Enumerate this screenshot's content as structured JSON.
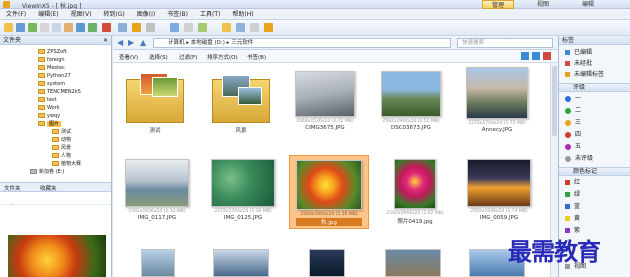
{
  "window": {
    "title": "ViewInX5 - [ 秋.jpg ]"
  },
  "ribbon_tabs": [
    {
      "label": "管理"
    },
    {
      "label": "视图"
    },
    {
      "label": "编辑"
    }
  ],
  "menu": [
    {
      "label": "文件(F)"
    },
    {
      "label": "编辑(E)"
    },
    {
      "label": "视图(V)"
    },
    {
      "label": "转到(G)"
    },
    {
      "label": "图像(I)"
    },
    {
      "label": "书签(B)"
    },
    {
      "label": "工具(T)"
    },
    {
      "label": "帮助(H)"
    }
  ],
  "left_panel": {
    "header": "文件夹",
    "tree": [
      {
        "label": "ZPSZoft"
      },
      {
        "label": "foreign"
      },
      {
        "label": "Mestec"
      },
      {
        "label": "Python27"
      },
      {
        "label": "system"
      },
      {
        "label": "TENCMEN2k5"
      },
      {
        "label": "test"
      },
      {
        "label": "Work"
      },
      {
        "label": "ywqy"
      },
      {
        "label": "图片"
      },
      {
        "label": "测试"
      },
      {
        "label": "动物"
      },
      {
        "label": "风景"
      },
      {
        "label": "人物"
      },
      {
        "label": "植物大赛"
      },
      {
        "label": "新加卷 (E:)"
      }
    ],
    "tabs": [
      {
        "label": "文件夹"
      },
      {
        "label": "收藏夹"
      }
    ],
    "preview_header": "预览"
  },
  "pathbar": {
    "crumbs": [
      "计算机",
      "本地磁盘 (D:)",
      "三元软件"
    ],
    "search_placeholder": "快速搜索"
  },
  "filterbar": {
    "items": [
      {
        "label": "查看(V)"
      },
      {
        "label": "选择(S)"
      },
      {
        "label": "过滤(F)"
      },
      {
        "label": "排序方式(O)"
      },
      {
        "label": "书签(B)"
      }
    ]
  },
  "thumbnails": [
    {
      "name": "测试",
      "meta": "",
      "kind": "folder"
    },
    {
      "name": "风景",
      "meta": "",
      "kind": "folder"
    },
    {
      "name": "CIMG3675.JPG",
      "meta": "2048x1536x24 (2.72 MB)",
      "kind": "photo"
    },
    {
      "name": "DSC03673.JPG",
      "meta": "2592x1944x24 (2.52 MB)",
      "kind": "photo"
    },
    {
      "name": "Annecy.JPG",
      "meta": "2272x1704x24 (1.75 MB)",
      "kind": "photo"
    },
    {
      "name": "IMG_0117.JPG",
      "meta": "2592x1936x24 (2.32 MB)",
      "kind": "photo"
    },
    {
      "name": "IMG_0125.JPG",
      "meta": "2272x1704x24 (1.39 MB)",
      "kind": "photo"
    },
    {
      "name": "秋.jpg",
      "meta": "2560x1600x24 (1.56 MB)",
      "kind": "photo"
    },
    {
      "name": "照片0419.jpg",
      "meta": "2592x1944x24 (1.62 MB)",
      "kind": "photo"
    },
    {
      "name": "IMG_0059.JPG",
      "meta": "2592x1936x24 (1.74 MB)",
      "kind": "photo"
    }
  ],
  "right_panel": {
    "header": "标签",
    "tag_items": [
      {
        "label": "已编辑"
      },
      {
        "label": "未经批"
      },
      {
        "label": "未编辑标签"
      }
    ],
    "rating_header": "评级",
    "ratings": [
      {
        "label": "一",
        "color": "#2a6fd6"
      },
      {
        "label": "二",
        "color": "#2aa63a"
      },
      {
        "label": "三",
        "color": "#e8a21c"
      },
      {
        "label": "四",
        "color": "#d23a2a"
      },
      {
        "label": "五",
        "color": "#b02ab0"
      },
      {
        "label": "未评级",
        "color": "#9a9a9a"
      }
    ],
    "color_header": "颜色标记",
    "colors": [
      {
        "label": "红",
        "color": "#d23a2a"
      },
      {
        "label": "绿",
        "color": "#2aa63a"
      },
      {
        "label": "蓝",
        "color": "#2a6fd6"
      },
      {
        "label": "黄",
        "color": "#e8d21c"
      },
      {
        "label": "紫",
        "color": "#8a3ad2"
      },
      {
        "label": "视图",
        "color": "#9a9a9a"
      }
    ]
  },
  "watermark": "最需教育"
}
